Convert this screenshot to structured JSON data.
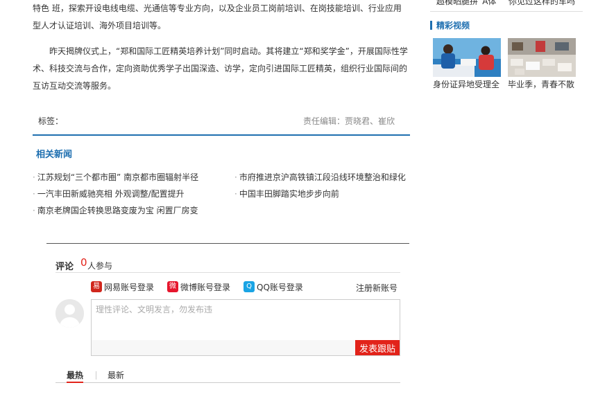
{
  "article": {
    "para1": "特色 班，探索开设电线电缆、光通信等专业方向，以及企业员工岗前培训、在岗技能培训、行业应用型人才认证培训、海外项目培训等。",
    "para2": "昨天揭牌仪式上，“郑和国际工匠精英培养计划”同时启动。其将建立“郑和奖学金”，开展国际性学术、科技交流与合作，定向资助优秀学子出国深造、访学，定向引进国际工匠精英，组织行业国际间的互访互动交流等服务。"
  },
  "tags": {
    "label": "标签：",
    "editor": "责任编辑：贾晓君、崔欣"
  },
  "related": {
    "title": "相关新闻",
    "items": [
      "江苏规划“三个都市圈” 南京都市圈辐射半径",
      "市府推进京沪高铁镇江段沿线环境整治和绿化",
      "一汽丰田新威驰亮相 外观调整/配置提升",
      "中国丰田脚踏实地步步向前",
      "南京老牌国企转换思路变废为宝  闲置厂房变"
    ]
  },
  "comments": {
    "title": "评论",
    "count": "0",
    "count_suffix": "人参与",
    "logins": [
      {
        "label": "网易账号登录",
        "icon": "netease-icon",
        "color": "#d0261c",
        "glyph": "易"
      },
      {
        "label": "微博账号登录",
        "icon": "weibo-icon",
        "color": "#e6162d",
        "glyph": "微"
      },
      {
        "label": "QQ账号登录",
        "icon": "qq-icon",
        "color": "#1aa4e4",
        "glyph": "Q"
      }
    ],
    "register": "注册新账号",
    "placeholder": "理性评论、文明发言，勿发布违",
    "submit": "发表跟贴",
    "tabs": [
      "最热",
      "最新"
    ],
    "accent": "#e2231a"
  },
  "sidebar": {
    "top_items": [
      "超模晒腿拼“A体”",
      "你见过这样的车吗"
    ],
    "section_title": "精彩视频",
    "videos": [
      {
        "caption": "身份证异地受理全"
      },
      {
        "caption": "毕业季，青春不散"
      }
    ]
  },
  "colors": {
    "brand_blue": "#1e6fb0",
    "accent_red": "#e2231a"
  }
}
